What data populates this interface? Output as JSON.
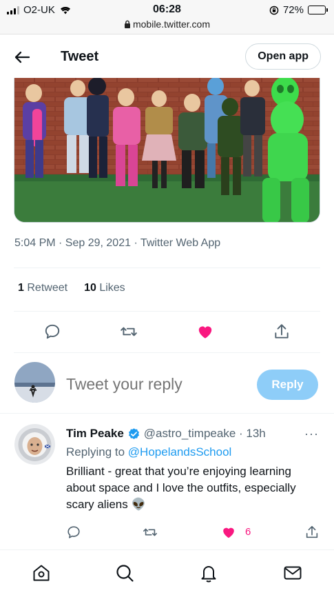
{
  "status_bar": {
    "carrier": "O2-UK",
    "time": "06:28",
    "url": "mobile.twitter.com",
    "battery": "72%",
    "battery_level": 0.72
  },
  "header": {
    "title": "Tweet",
    "open_app_label": "Open app"
  },
  "tweet": {
    "timestamp": "5:04 PM · Sep 29, 2021 · Twitter Web App",
    "retweets_count": "1",
    "retweets_label": "Retweet",
    "likes_count": "10",
    "likes_label": "Likes",
    "liked": true
  },
  "reply_box": {
    "placeholder": "Tweet your reply",
    "button_label": "Reply"
  },
  "reply_tweet": {
    "name": "Tim Peake",
    "handle": "@astro_timpeake · 13h",
    "more": "···",
    "replying_prefix": "Replying to",
    "replying_to": "@HopelandsSchool",
    "body": "Brilliant - great that you’re enjoying learning about space and I love the outfits, especially scary aliens 👽",
    "like_count": "6"
  },
  "colors": {
    "accent": "#1d9bf0",
    "like": "#f91880",
    "reply_button": "#8ecdf8"
  },
  "icons": {
    "back": "arrow-left-icon",
    "reply": "speech-bubble-icon",
    "retweet": "retweet-icon",
    "like": "heart-icon",
    "share": "share-icon",
    "home": "home-icon",
    "search": "search-icon",
    "notifications": "bell-icon",
    "messages": "envelope-icon"
  }
}
